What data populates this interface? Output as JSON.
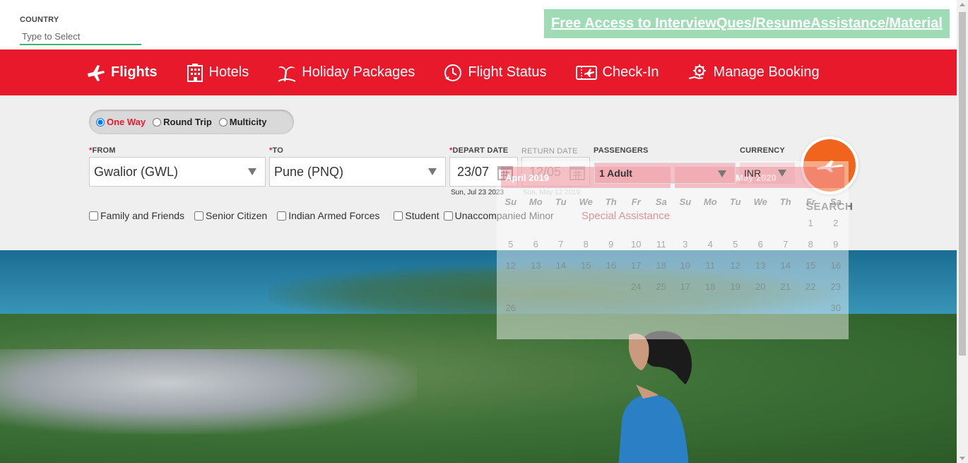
{
  "top": {
    "country_label": "COUNTRY",
    "country_placeholder": "Type to Select",
    "promo_link": "Free Access to InterviewQues/ResumeAssistance/Material"
  },
  "nav": {
    "items": [
      {
        "label": "Flights",
        "icon": "airplane-icon"
      },
      {
        "label": "Hotels",
        "icon": "hotel-building-icon"
      },
      {
        "label": "Holiday Packages",
        "icon": "palm-tree-icon"
      },
      {
        "label": "Flight Status",
        "icon": "clock-plane-icon"
      },
      {
        "label": "Check-In",
        "icon": "ticket-icon"
      },
      {
        "label": "Manage Booking",
        "icon": "gear-hand-icon"
      }
    ],
    "active": "Flights",
    "bg_color": "#e9192c"
  },
  "trip": {
    "options": [
      "One Way",
      "Round Trip",
      "Multicity"
    ],
    "selected": "One Way"
  },
  "form": {
    "from_label": "FROM",
    "from_value": "Gwalior (GWL)",
    "to_label": "TO",
    "to_value": "Pune (PNQ)",
    "depart_label": "DEPART DATE",
    "depart_value": "23/07",
    "depart_sub": "Sun, Jul 23 2023",
    "return_label": "RETURN DATE",
    "return_value": "12/05",
    "return_sub": "Sun, May 12 2019",
    "passengers_label": "PASSENGERS",
    "passengers_value": "1 Adult",
    "currency_label": "CURRENCY",
    "currency_value": "INR",
    "search_label": "SEARCH",
    "required_mark": "*"
  },
  "checkboxes": [
    "Family and Friends",
    "Senior Citizen",
    "Indian Armed Forces",
    "Student",
    "Unaccompanied Minor"
  ],
  "special_assistance": "Special Assistance",
  "calendar_ghost": {
    "month_left": "April 2019",
    "month_right": "May 2020",
    "weekdays": [
      "Su",
      "Mo",
      "Tu",
      "We",
      "Th",
      "Fr",
      "Sa"
    ],
    "left_days": [
      "",
      "",
      "",
      "",
      "",
      "",
      "",
      "5",
      "6",
      "7",
      "8",
      "9",
      "10",
      "11",
      "12",
      "13",
      "14",
      "15",
      "16",
      "17",
      "18",
      "",
      "",
      "",
      "",
      "",
      "24",
      "25",
      "26"
    ],
    "right_days": [
      "",
      "",
      "",
      "",
      "",
      "1",
      "2",
      "3",
      "4",
      "5",
      "6",
      "7",
      "8",
      "9",
      "10",
      "11",
      "12",
      "13",
      "14",
      "15",
      "16",
      "17",
      "18",
      "19",
      "20",
      "21",
      "22",
      "23",
      "",
      "",
      "",
      "",
      "",
      "",
      "30"
    ]
  }
}
